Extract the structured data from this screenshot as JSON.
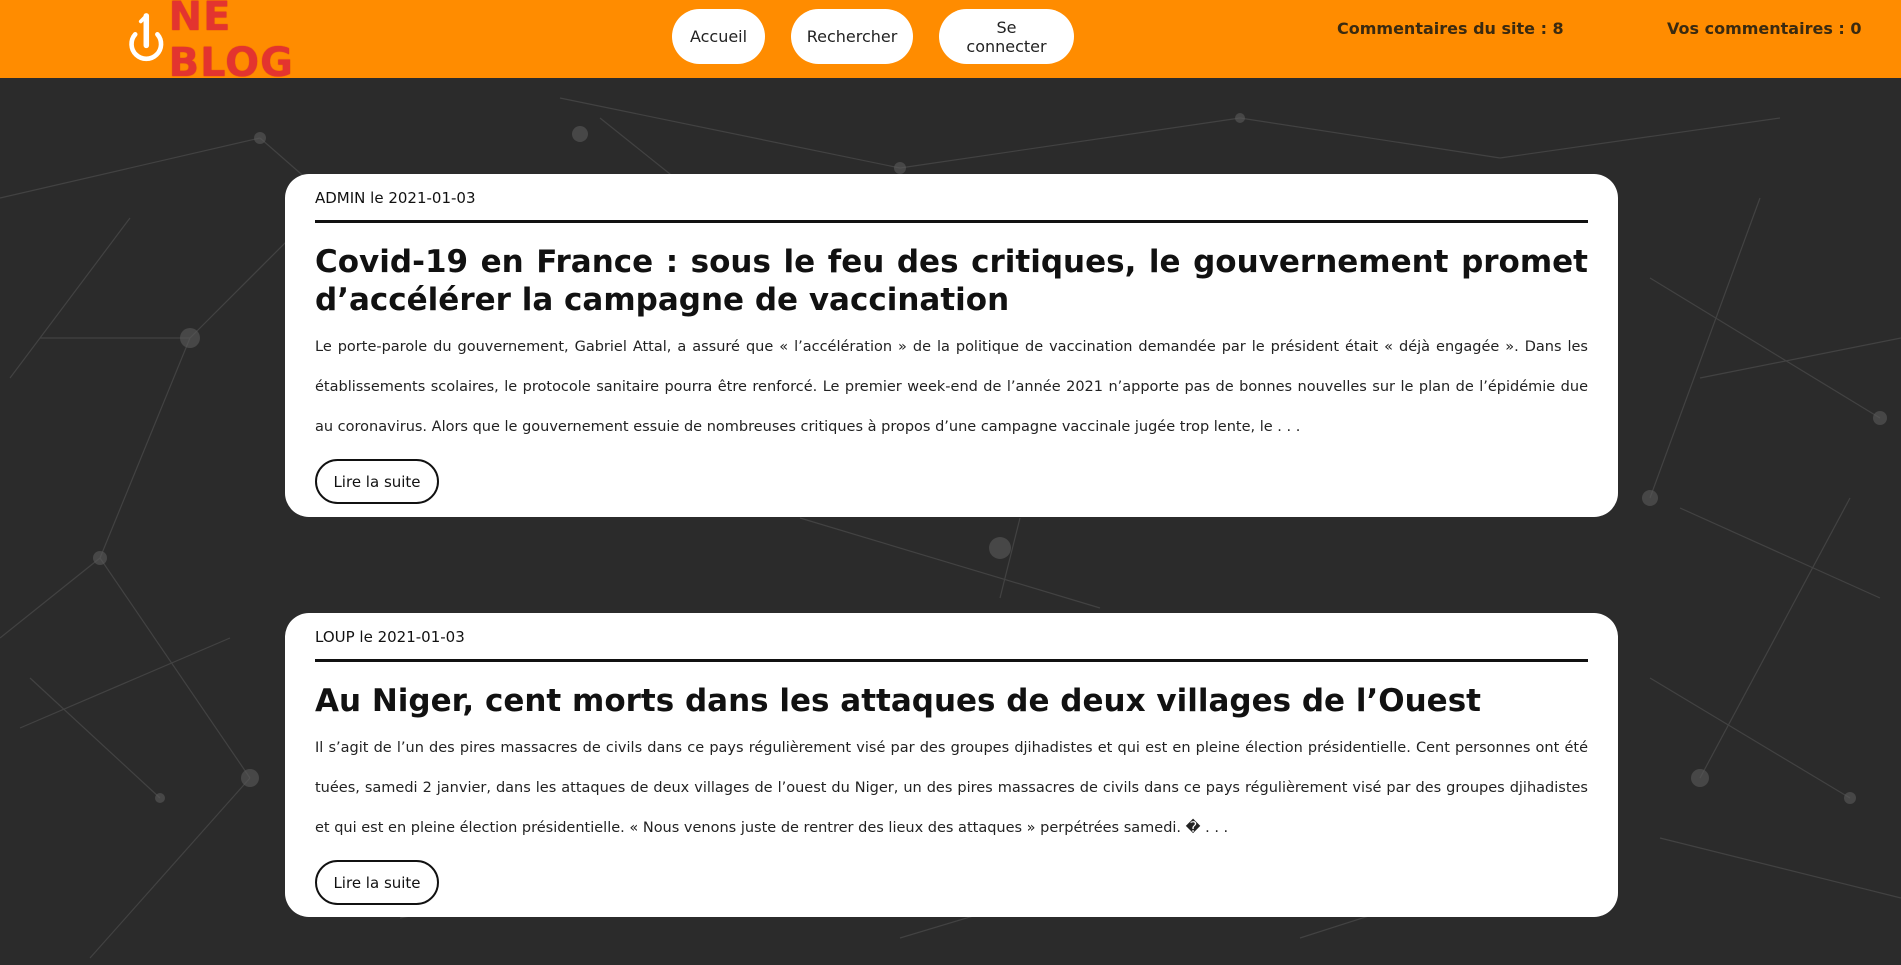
{
  "header": {
    "logo_text": "NE BLOG",
    "nav": [
      {
        "label": "Accueil"
      },
      {
        "label": "Rechercher"
      },
      {
        "label": "Se connecter"
      }
    ],
    "site_comments": "Commentaires du site : 8",
    "your_comments": "Vos commentaires : 0"
  },
  "colors": {
    "header_bg": "#ff8c00",
    "logo_red": "#e3342f",
    "page_bg": "#2b2b2b"
  },
  "posts": [
    {
      "meta": "ADMIN le 2021-01-03",
      "title": "Covid-19 en France : sous le feu des critiques, le gouvernement promet d’accélérer la campagne de vaccination",
      "excerpt": "Le porte-parole du gouvernement, Gabriel Attal, a assuré que « l’accélération » de la politique de vaccination demandée par le président était « déjà engagée ». Dans les établissements scolaires, le protocole sanitaire pourra être renforcé. Le premier week-end de l’année 2021 n’apporte pas de bonnes nouvelles sur le plan de l’épidémie due au coronavirus. Alors que le gouvernement essuie de nombreuses critiques à propos d’une campagne vaccinale jugée trop lente, le . . .",
      "read_more": "Lire la suite"
    },
    {
      "meta": "LOUP le 2021-01-03",
      "title": "Au Niger, cent morts dans les attaques de deux villages de l’Ouest",
      "excerpt": "Il s’agit de l’un des pires massacres de civils dans ce pays régulièrement visé par des groupes djihadistes et qui est en pleine élection présidentielle. Cent personnes ont été tuées, samedi 2 janvier, dans les attaques de deux villages de l’ouest du Niger, un des pires massacres de civils dans ce pays régulièrement visé par des groupes djihadistes et qui est en pleine élection présidentielle. « Nous venons juste de rentrer des lieux des attaques » perpétrées samedi. � . . .",
      "read_more": "Lire la suite"
    }
  ]
}
